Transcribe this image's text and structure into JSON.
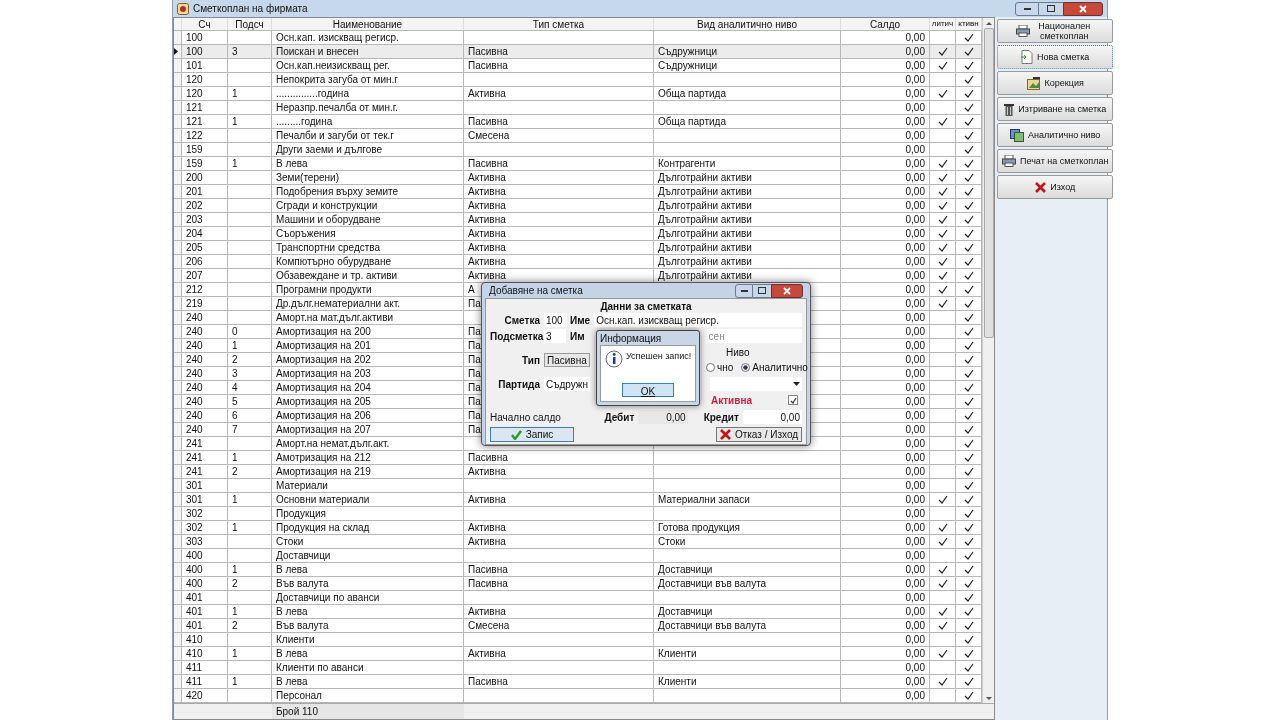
{
  "window": {
    "title": "Сметкоплан на фирмата"
  },
  "table": {
    "columns": [
      "Сч",
      "Подсч",
      "Наименование",
      "Тип сметка",
      "Вид аналитично ниво",
      "Салдо",
      "литич",
      "ктивн"
    ],
    "rows": [
      {
        "code": "100",
        "name": "Осн.кап. изискващ региср.",
        "saldo": "0,00",
        "analytic": false,
        "active": true,
        "selected": false
      },
      {
        "code": "100",
        "sub": "3",
        "name": "Поискан и внесен",
        "type": "Пасивна",
        "level": "Съдружници",
        "saldo": "0,00",
        "analytic": true,
        "active": true,
        "selected": true
      },
      {
        "code": "101",
        "name": "Осн.кап.неизискващ рег.",
        "type": "Пасивна",
        "level": "Съдружници",
        "saldo": "0,00",
        "analytic": true,
        "active": true,
        "selected": false
      },
      {
        "code": "120",
        "name": "Непокрита загуба от мин.г",
        "saldo": "0,00",
        "analytic": false,
        "active": true,
        "selected": false
      },
      {
        "code": "120",
        "sub": "1",
        "name": "...............година",
        "type": "Активна",
        "level": "Обща партида",
        "saldo": "0,00",
        "analytic": true,
        "active": true,
        "selected": false
      },
      {
        "code": "121",
        "name": "Неразпр.печалба от мин.г.",
        "saldo": "0,00",
        "analytic": false,
        "active": true,
        "selected": false
      },
      {
        "code": "121",
        "sub": "1",
        "name": ".........година",
        "type": "Пасивна",
        "level": "Обща партида",
        "saldo": "0,00",
        "analytic": true,
        "active": true,
        "selected": false
      },
      {
        "code": "122",
        "name": "Печалби и загуби от тек.г",
        "type": "Смесена",
        "saldo": "0,00",
        "analytic": false,
        "active": true,
        "selected": false
      },
      {
        "code": "159",
        "name": "Други заеми и дългове",
        "saldo": "0,00",
        "analytic": false,
        "active": true,
        "selected": false
      },
      {
        "code": "159",
        "sub": "1",
        "name": "В лева",
        "type": "Пасивна",
        "level": "Контрагенти",
        "saldo": "0,00",
        "analytic": true,
        "active": true,
        "selected": false
      },
      {
        "code": "200",
        "name": "Земи(терени)",
        "type": "Активна",
        "level": "Дълготрайни активи",
        "saldo": "0,00",
        "analytic": true,
        "active": true,
        "selected": false
      },
      {
        "code": "201",
        "name": "Подобрения върху земите",
        "type": "Активна",
        "level": "Дълготрайни активи",
        "saldo": "0,00",
        "analytic": true,
        "active": true,
        "selected": false
      },
      {
        "code": "202",
        "name": "Сгради и конструкции",
        "type": "Активна",
        "level": "Дълготрайни активи",
        "saldo": "0,00",
        "analytic": true,
        "active": true,
        "selected": false
      },
      {
        "code": "203",
        "name": "Машини и оборудване",
        "type": "Активна",
        "level": "Дълготрайни активи",
        "saldo": "0,00",
        "analytic": true,
        "active": true,
        "selected": false
      },
      {
        "code": "204",
        "name": "Съоръжения",
        "type": "Активна",
        "level": "Дълготрайни активи",
        "saldo": "0,00",
        "analytic": true,
        "active": true,
        "selected": false
      },
      {
        "code": "205",
        "name": "Транспортни средства",
        "type": "Активна",
        "level": "Дълготрайни активи",
        "saldo": "0,00",
        "analytic": true,
        "active": true,
        "selected": false
      },
      {
        "code": "206",
        "name": "Компютърно обурудване",
        "type": "Активна",
        "level": "Дълготрайни активи",
        "saldo": "0,00",
        "analytic": true,
        "active": true,
        "selected": false
      },
      {
        "code": "207",
        "name": "Обзавеждане и тр. активи",
        "type": "Активна",
        "level": "Дълготрайни активи",
        "saldo": "0,00",
        "analytic": true,
        "active": true,
        "selected": false
      },
      {
        "code": "212",
        "name": "Програмни продукти",
        "type": "А",
        "saldo": "0,00",
        "analytic": true,
        "active": true,
        "selected": false
      },
      {
        "code": "219",
        "name": "Др.дълг.нематериални акт.",
        "type": "Па",
        "saldo": "0,00",
        "analytic": true,
        "active": true,
        "selected": false
      },
      {
        "code": "240",
        "name": "Аморт.на мат.дълг.активи",
        "saldo": "0,00",
        "analytic": false,
        "active": true,
        "selected": false
      },
      {
        "code": "240",
        "sub": "0",
        "name": "Амортизация на 200",
        "type": "Па",
        "saldo": "0,00",
        "analytic": false,
        "active": true,
        "selected": false
      },
      {
        "code": "240",
        "sub": "1",
        "name": "Амортизация на 201",
        "type": "Па",
        "saldo": "0,00",
        "analytic": false,
        "active": true,
        "selected": false
      },
      {
        "code": "240",
        "sub": "2",
        "name": "Амортизация на 202",
        "type": "Па",
        "saldo": "0,00",
        "analytic": false,
        "active": true,
        "selected": false
      },
      {
        "code": "240",
        "sub": "3",
        "name": "Амортизация на 203",
        "type": "Па",
        "saldo": "0,00",
        "analytic": false,
        "active": true,
        "selected": false
      },
      {
        "code": "240",
        "sub": "4",
        "name": "Амортизация на 204",
        "type": "Па",
        "saldo": "0,00",
        "analytic": false,
        "active": true,
        "selected": false
      },
      {
        "code": "240",
        "sub": "5",
        "name": "Амортизация на 205",
        "type": "Па",
        "saldo": "0,00",
        "analytic": false,
        "active": true,
        "selected": false
      },
      {
        "code": "240",
        "sub": "6",
        "name": "Амортизация на 206",
        "type": "Па",
        "saldo": "0,00",
        "analytic": false,
        "active": true,
        "selected": false
      },
      {
        "code": "240",
        "sub": "7",
        "name": "Амортизация на 207",
        "type": "Па",
        "saldo": "0,00",
        "analytic": false,
        "active": true,
        "selected": false
      },
      {
        "code": "241",
        "name": "Аморт.на немат.дълг.акт.",
        "saldo": "0,00",
        "analytic": false,
        "active": true,
        "selected": false
      },
      {
        "code": "241",
        "sub": "1",
        "name": "Амотризация на 212",
        "type": "Пасивна",
        "saldo": "0,00",
        "analytic": false,
        "active": true,
        "selected": false
      },
      {
        "code": "241",
        "sub": "2",
        "name": "Амортизация на 219",
        "type": "Активна",
        "saldo": "0,00",
        "analytic": false,
        "active": true,
        "selected": false
      },
      {
        "code": "301",
        "name": "Материали",
        "saldo": "0,00",
        "analytic": false,
        "active": true,
        "selected": false
      },
      {
        "code": "301",
        "sub": "1",
        "name": "Основни материали",
        "type": "Активна",
        "level": "Материални запаси",
        "saldo": "0,00",
        "analytic": true,
        "active": true,
        "selected": false
      },
      {
        "code": "302",
        "name": "Продукция",
        "saldo": "0,00",
        "analytic": false,
        "active": true,
        "selected": false
      },
      {
        "code": "302",
        "sub": "1",
        "name": "Продукция на склад",
        "type": "Активна",
        "level": "Готова продукция",
        "saldo": "0,00",
        "analytic": true,
        "active": true,
        "selected": false
      },
      {
        "code": "303",
        "name": "Стоки",
        "type": "Активна",
        "level": "Стоки",
        "saldo": "0,00",
        "analytic": true,
        "active": true,
        "selected": false
      },
      {
        "code": "400",
        "name": "Доставчици",
        "saldo": "0,00",
        "analytic": false,
        "active": true,
        "selected": false
      },
      {
        "code": "400",
        "sub": "1",
        "name": "В лева",
        "type": "Пасивна",
        "level": "Доставчици",
        "saldo": "0,00",
        "analytic": true,
        "active": true,
        "selected": false
      },
      {
        "code": "400",
        "sub": "2",
        "name": "Във валута",
        "type": "Пасивна",
        "level": "Доставчици във валута",
        "saldo": "0,00",
        "analytic": true,
        "active": true,
        "selected": false
      },
      {
        "code": "401",
        "name": "Доставчици по аванси",
        "saldo": "0,00",
        "analytic": false,
        "active": true,
        "selected": false
      },
      {
        "code": "401",
        "sub": "1",
        "name": "В лева",
        "type": "Активна",
        "level": "Доставчици",
        "saldo": "0,00",
        "analytic": true,
        "active": true,
        "selected": false
      },
      {
        "code": "401",
        "sub": "2",
        "name": "Във валута",
        "type": "Смесена",
        "level": "Доставчици във валута",
        "saldo": "0,00",
        "analytic": true,
        "active": true,
        "selected": false
      },
      {
        "code": "410",
        "name": "Клиенти",
        "saldo": "0,00",
        "analytic": false,
        "active": true,
        "selected": false
      },
      {
        "code": "410",
        "sub": "1",
        "name": "В лева",
        "type": "Активна",
        "level": "Клиенти",
        "saldo": "0,00",
        "analytic": true,
        "active": true,
        "selected": false
      },
      {
        "code": "411",
        "name": "Клиенти по аванси",
        "saldo": "0,00",
        "analytic": false,
        "active": true,
        "selected": false
      },
      {
        "code": "411",
        "sub": "1",
        "name": "В лева",
        "type": "Пасивна",
        "level": "Клиенти",
        "saldo": "0,00",
        "analytic": true,
        "active": true,
        "selected": false
      },
      {
        "code": "420",
        "name": "Персонал",
        "saldo": "0,00",
        "analytic": false,
        "active": true,
        "selected": false
      }
    ],
    "footer": "Брой 110"
  },
  "side_buttons": [
    {
      "label": "Национален сметкоплан",
      "kind": "printer",
      "selected": false
    },
    {
      "label": "Нова сметка",
      "kind": "document",
      "selected": true
    },
    {
      "label": "Корекция",
      "kind": "edit",
      "selected": false
    },
    {
      "label": "Изтриване на сметка",
      "kind": "trash",
      "selected": false
    },
    {
      "label": "Аналитично ниво",
      "kind": "image",
      "selected": false
    },
    {
      "label": "Печат на сметкоплан",
      "kind": "printer",
      "selected": false
    },
    {
      "label": "Изход",
      "kind": "close",
      "selected": false
    }
  ],
  "dialog": {
    "title": "Добавяне на сметка",
    "heading": "Данни за сметката",
    "account_label": "Сметка",
    "account": "100",
    "name_label": "Име",
    "name": "Осн.кап. изискващ региср.",
    "sub_label": "Подсметка",
    "sub": "3",
    "name2_label": "Им",
    "name2": "сен",
    "type_label": "Тип",
    "type": "Пасивна",
    "level_group": "Ниво",
    "radios": [
      {
        "label": "чно",
        "selected": false
      },
      {
        "label": "Аналитично",
        "selected": true
      }
    ],
    "batch_label": "Партида",
    "batch": "Съдружн",
    "active_label": "Активна",
    "active": true,
    "opening_label": "Начално салдо",
    "debit_label": "Дебит",
    "debit": "0,00",
    "credit_label": "Кредит",
    "credit": "0,00",
    "save": "Запис",
    "cancel": "Отказ / Изход"
  },
  "message": {
    "title": "Информация",
    "text": "Успешен запис!",
    "ok": "OK"
  }
}
